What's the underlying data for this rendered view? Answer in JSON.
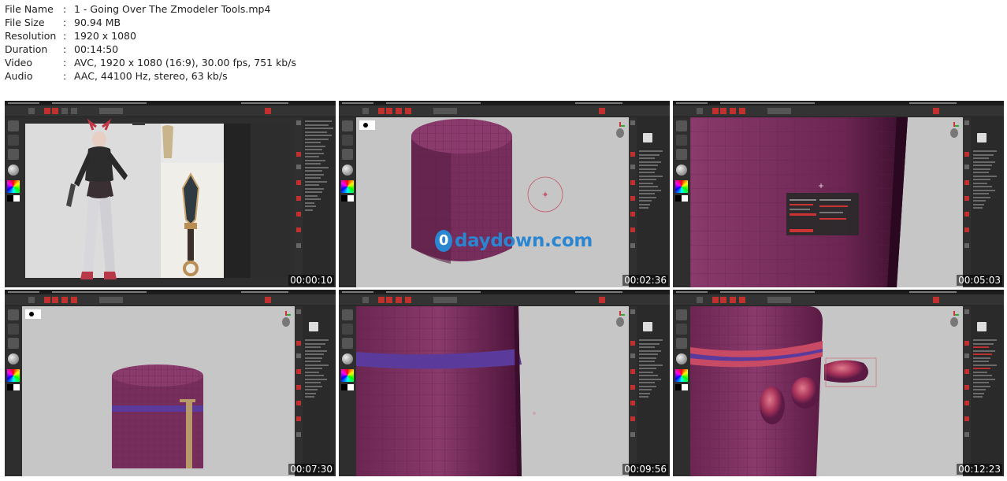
{
  "file_info": [
    {
      "key": "File Name",
      "value": "1 - Going Over The Zmodeler Tools.mp4"
    },
    {
      "key": "File Size",
      "value": "90.94 MB"
    },
    {
      "key": "Resolution",
      "value": "1920 x 1080"
    },
    {
      "key": "Duration",
      "value": "00:14:50"
    },
    {
      "key": "Video",
      "value": "AVC, 1920 x 1080 (16:9), 30.00 fps, 751 kb/s"
    },
    {
      "key": "Audio",
      "value": "AAC, 44100 Hz, stereo, 63 kb/s"
    }
  ],
  "separator": ":",
  "thumbnails": [
    {
      "timestamp": "00:00:10",
      "scene": "character-reference"
    },
    {
      "timestamp": "00:02:36",
      "scene": "cylinder"
    },
    {
      "timestamp": "00:05:03",
      "scene": "closeup-menu"
    },
    {
      "timestamp": "00:07:30",
      "scene": "small-cylinder"
    },
    {
      "timestamp": "00:09:56",
      "scene": "cylinder-band"
    },
    {
      "timestamp": "00:12:23",
      "scene": "cylinder-knobs"
    }
  ],
  "watermark": {
    "glyph": "0",
    "text": "daydown.com"
  },
  "colors": {
    "ui_dark": "#2b2b2b",
    "viewport": "#c6c6c6",
    "mesh": "#7a2f5e",
    "accent_red": "#c0302d",
    "watermark_blue": "#2a86d1"
  }
}
